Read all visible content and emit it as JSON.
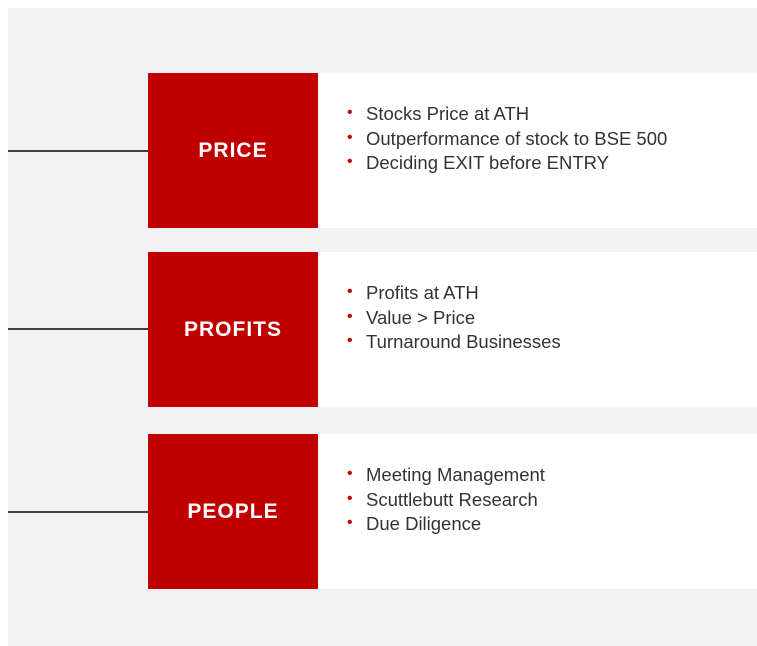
{
  "colors": {
    "accent": "#c00000",
    "panel_bg": "#f2f2f2",
    "card_bg": "#ffffff",
    "connector": "#404040",
    "text": "#333333"
  },
  "categories": [
    {
      "label": "PRICE",
      "items": [
        "Stocks Price at ATH",
        "Outperformance of stock to BSE 500",
        "Deciding EXIT before ENTRY"
      ]
    },
    {
      "label": "PROFITS",
      "items": [
        "Profits at ATH",
        "Value > Price",
        "Turnaround Businesses"
      ]
    },
    {
      "label": "PEOPLE",
      "items": [
        "Meeting Management",
        "Scuttlebutt Research",
        "Due Diligence"
      ]
    }
  ]
}
